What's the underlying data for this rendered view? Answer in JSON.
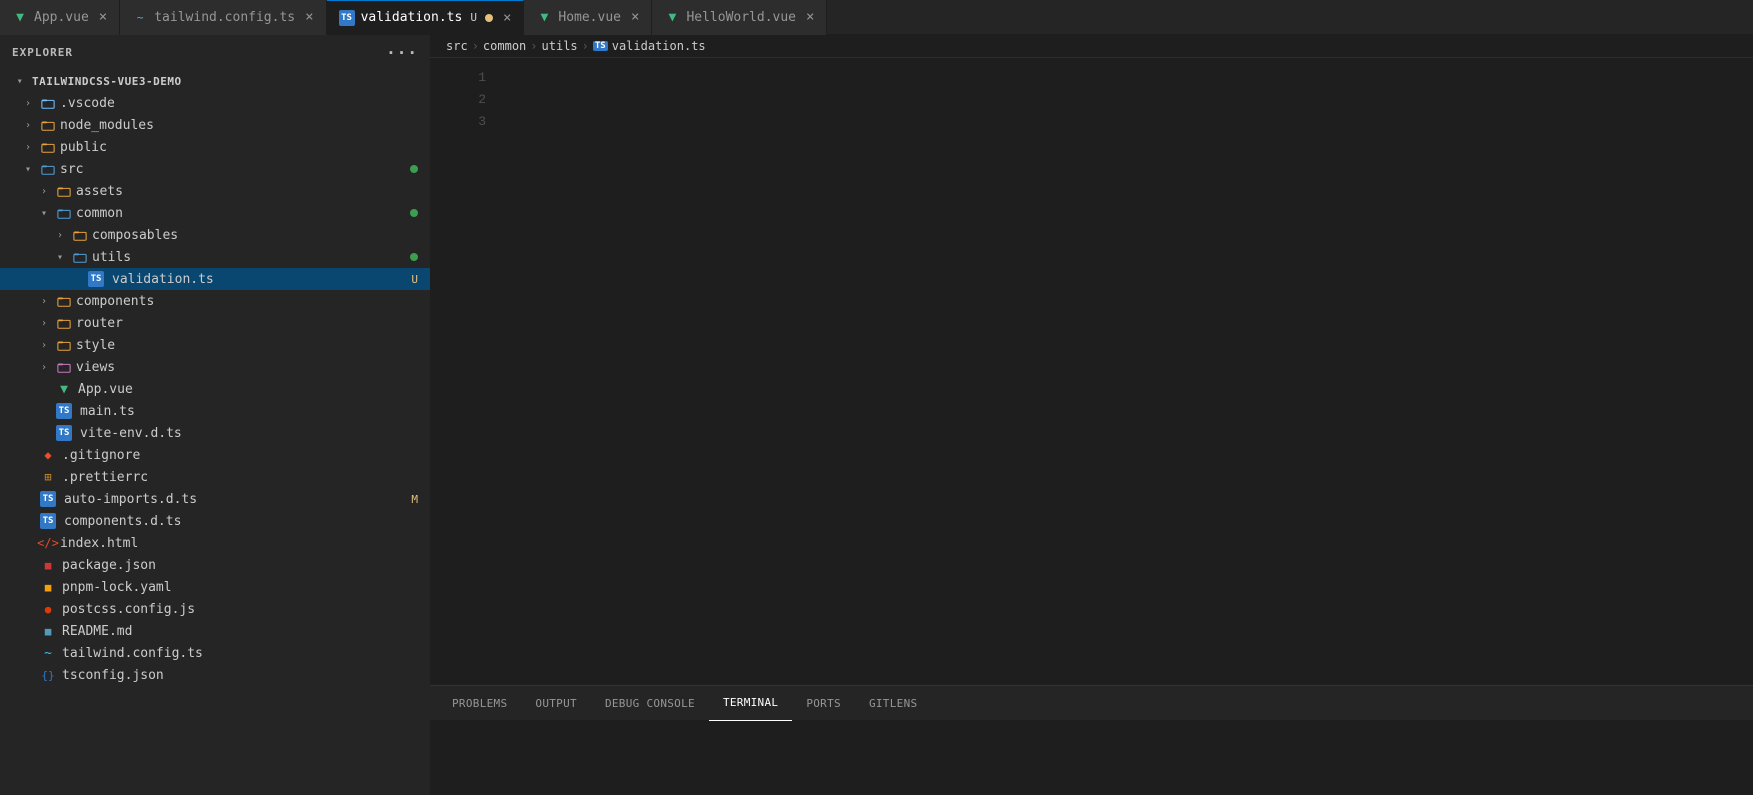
{
  "sidebar": {
    "header": "Explorer",
    "more_actions": "···",
    "project": {
      "name": "TAILWINDCSS-VUE3-DEMO",
      "expanded": true
    },
    "tree": [
      {
        "id": "vscode",
        "label": ".vscode",
        "type": "folder",
        "icon": "vscode",
        "indent": 1,
        "expanded": false,
        "badge": ""
      },
      {
        "id": "node_modules",
        "label": "node_modules",
        "type": "folder",
        "icon": "node",
        "indent": 1,
        "expanded": false,
        "badge": ""
      },
      {
        "id": "public",
        "label": "public",
        "type": "folder",
        "icon": "folder",
        "indent": 1,
        "expanded": false,
        "badge": ""
      },
      {
        "id": "src",
        "label": "src",
        "type": "folder",
        "icon": "folder-blue",
        "indent": 1,
        "expanded": true,
        "badge": "dot-green"
      },
      {
        "id": "assets",
        "label": "assets",
        "type": "folder",
        "icon": "folder",
        "indent": 2,
        "expanded": false,
        "badge": ""
      },
      {
        "id": "common",
        "label": "common",
        "type": "folder",
        "icon": "folder-blue",
        "indent": 2,
        "expanded": true,
        "badge": "dot-green"
      },
      {
        "id": "composables",
        "label": "composables",
        "type": "folder",
        "icon": "folder",
        "indent": 3,
        "expanded": false,
        "badge": ""
      },
      {
        "id": "utils",
        "label": "utils",
        "type": "folder",
        "icon": "folder-blue",
        "indent": 3,
        "expanded": true,
        "badge": "dot-green"
      },
      {
        "id": "validation-ts",
        "label": "validation.ts",
        "type": "ts",
        "indent": 4,
        "badge": "U",
        "selected": true
      },
      {
        "id": "components",
        "label": "components",
        "type": "folder",
        "icon": "folder",
        "indent": 2,
        "expanded": false,
        "badge": ""
      },
      {
        "id": "router",
        "label": "router",
        "type": "folder",
        "icon": "folder",
        "indent": 2,
        "expanded": false,
        "badge": ""
      },
      {
        "id": "style",
        "label": "style",
        "type": "folder",
        "icon": "folder",
        "indent": 2,
        "expanded": false,
        "badge": ""
      },
      {
        "id": "views",
        "label": "views",
        "type": "folder",
        "icon": "views",
        "indent": 2,
        "expanded": false,
        "badge": ""
      },
      {
        "id": "App-vue",
        "label": "App.vue",
        "type": "vue",
        "indent": 2,
        "badge": ""
      },
      {
        "id": "main-ts",
        "label": "main.ts",
        "type": "ts",
        "indent": 2,
        "badge": ""
      },
      {
        "id": "vite-env",
        "label": "vite-env.d.ts",
        "type": "ts",
        "indent": 2,
        "badge": ""
      },
      {
        "id": "gitignore",
        "label": ".gitignore",
        "type": "gitignore",
        "indent": 1,
        "badge": ""
      },
      {
        "id": "prettierrc",
        "label": ".prettierrc",
        "type": "prettierrc",
        "indent": 1,
        "badge": ""
      },
      {
        "id": "auto-imports",
        "label": "auto-imports.d.ts",
        "type": "ts",
        "indent": 1,
        "badge": "M"
      },
      {
        "id": "components-d",
        "label": "components.d.ts",
        "type": "ts",
        "indent": 1,
        "badge": ""
      },
      {
        "id": "index-html",
        "label": "index.html",
        "type": "html",
        "indent": 1,
        "badge": ""
      },
      {
        "id": "package-json",
        "label": "package.json",
        "type": "json",
        "indent": 1,
        "badge": ""
      },
      {
        "id": "pnpm-lock",
        "label": "pnpm-lock.yaml",
        "type": "yaml",
        "indent": 1,
        "badge": ""
      },
      {
        "id": "postcss",
        "label": "postcss.config.js",
        "type": "postcss",
        "indent": 1,
        "badge": ""
      },
      {
        "id": "readme",
        "label": "README.md",
        "type": "readme",
        "indent": 1,
        "badge": ""
      },
      {
        "id": "tailwind-config",
        "label": "tailwind.config.ts",
        "type": "tailwind",
        "indent": 1,
        "badge": ""
      },
      {
        "id": "tsconfig",
        "label": "tsconfig.json",
        "type": "tsconfig",
        "indent": 1,
        "badge": ""
      }
    ]
  },
  "tabs": [
    {
      "id": "app-vue",
      "label": "App.vue",
      "icon": "vue",
      "active": false,
      "modified": false
    },
    {
      "id": "tailwind-config",
      "label": "tailwind.config.ts",
      "icon": "tailwind",
      "active": false,
      "modified": false
    },
    {
      "id": "validation-ts",
      "label": "validation.ts",
      "icon": "ts",
      "active": true,
      "modified": true
    },
    {
      "id": "home-vue",
      "label": "Home.vue",
      "icon": "vue",
      "active": false,
      "modified": false
    },
    {
      "id": "helloworld-vue",
      "label": "HelloWorld.vue",
      "icon": "vue",
      "active": false,
      "modified": false
    }
  ],
  "breadcrumb": {
    "parts": [
      "src",
      "common",
      "utils",
      "validation.ts"
    ]
  },
  "editor": {
    "lines": [
      {
        "num": "1",
        "content": ""
      },
      {
        "num": "2",
        "content": ""
      },
      {
        "num": "3",
        "content": ""
      }
    ]
  },
  "panel": {
    "tabs": [
      "PROBLEMS",
      "OUTPUT",
      "DEBUG CONSOLE",
      "TERMINAL",
      "PORTS",
      "GITLENS"
    ],
    "active": "TERMINAL"
  }
}
